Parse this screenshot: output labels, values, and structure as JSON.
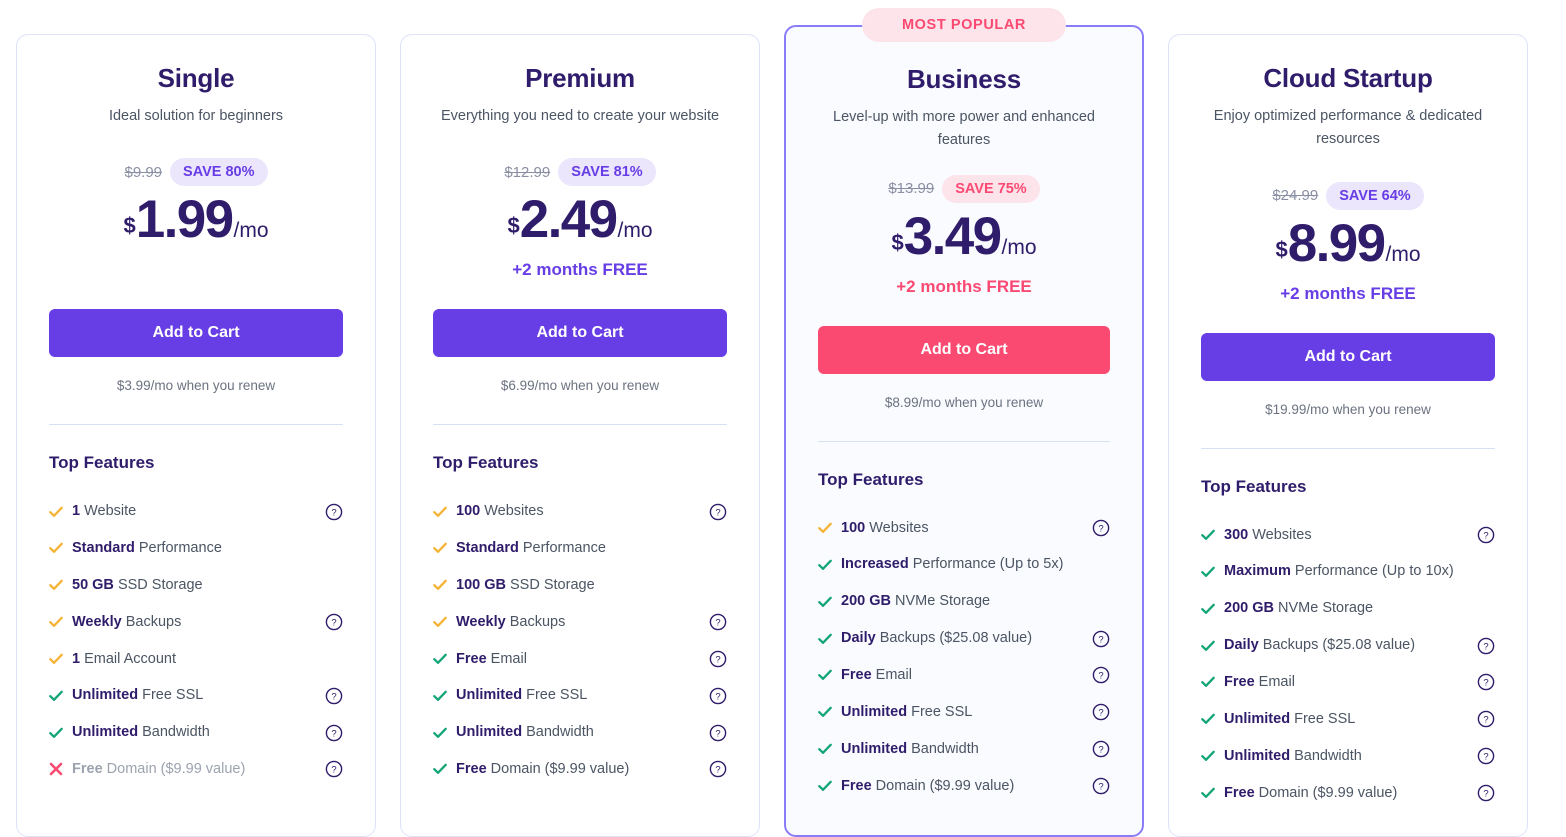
{
  "colors": {
    "purple": "#673de6",
    "pink": "#fb4a72",
    "navy": "#2f1c6a",
    "yellow_check": "#f5b335",
    "green_check": "#12a577",
    "border": "#dfe3fa",
    "featured_border": "#8a7bf7"
  },
  "popular_badge": "MOST POPULAR",
  "features_title": "Top Features",
  "cta_label": "Add to Cart",
  "currency": "$",
  "period": "/mo",
  "plans": [
    {
      "name": "Single",
      "description": "Ideal solution for beginners",
      "old_price": "$9.99",
      "save_label": "SAVE 80%",
      "amount": "1.99",
      "bonus": "",
      "renew": "$3.99/mo when you renew",
      "featured": false,
      "features": [
        {
          "bold": "1",
          "rest": " Website",
          "mark": "check-yellow",
          "help": true
        },
        {
          "bold": "Standard",
          "rest": " Performance",
          "mark": "check-yellow",
          "help": false
        },
        {
          "bold": "50 GB",
          "rest": " SSD Storage",
          "mark": "check-yellow",
          "help": false
        },
        {
          "bold": "Weekly",
          "rest": " Backups",
          "mark": "check-yellow",
          "help": true
        },
        {
          "bold": "1",
          "rest": " Email Account",
          "mark": "check-yellow",
          "help": false
        },
        {
          "bold": "Unlimited",
          "rest": " Free SSL",
          "mark": "check-green",
          "help": true
        },
        {
          "bold": "Unlimited",
          "rest": " Bandwidth",
          "mark": "check-green",
          "help": true
        },
        {
          "bold": "Free",
          "rest": " Domain ($9.99 value)",
          "mark": "cross-pink",
          "help": true,
          "muted": true
        }
      ]
    },
    {
      "name": "Premium",
      "description": "Everything you need to create your website",
      "old_price": "$12.99",
      "save_label": "SAVE 81%",
      "amount": "2.49",
      "bonus": "+2 months FREE",
      "renew": "$6.99/mo when you renew",
      "featured": false,
      "features": [
        {
          "bold": "100",
          "rest": " Websites",
          "mark": "check-yellow",
          "help": true
        },
        {
          "bold": "Standard",
          "rest": " Performance",
          "mark": "check-yellow",
          "help": false
        },
        {
          "bold": "100 GB",
          "rest": " SSD Storage",
          "mark": "check-yellow",
          "help": false
        },
        {
          "bold": "Weekly",
          "rest": " Backups",
          "mark": "check-yellow",
          "help": true
        },
        {
          "bold": "Free",
          "rest": " Email",
          "mark": "check-green",
          "help": true
        },
        {
          "bold": "Unlimited",
          "rest": " Free SSL",
          "mark": "check-green",
          "help": true
        },
        {
          "bold": "Unlimited",
          "rest": " Bandwidth",
          "mark": "check-green",
          "help": true
        },
        {
          "bold": "Free",
          "rest": " Domain ($9.99 value)",
          "mark": "check-green",
          "help": true
        }
      ]
    },
    {
      "name": "Business",
      "description": "Level-up with more power and enhanced features",
      "old_price": "$13.99",
      "save_label": "SAVE 75%",
      "amount": "3.49",
      "bonus": "+2 months FREE",
      "renew": "$8.99/mo when you renew",
      "featured": true,
      "features": [
        {
          "bold": "100",
          "rest": " Websites",
          "mark": "check-yellow",
          "help": true
        },
        {
          "bold": "Increased",
          "rest": " Performance (Up to 5x)",
          "mark": "check-green",
          "help": false
        },
        {
          "bold": "200 GB",
          "rest": " NVMe Storage",
          "mark": "check-green",
          "help": false
        },
        {
          "bold": "Daily",
          "rest": " Backups ($25.08 value)",
          "mark": "check-green",
          "help": true
        },
        {
          "bold": "Free",
          "rest": " Email",
          "mark": "check-green",
          "help": true
        },
        {
          "bold": "Unlimited",
          "rest": " Free SSL",
          "mark": "check-green",
          "help": true
        },
        {
          "bold": "Unlimited",
          "rest": " Bandwidth",
          "mark": "check-green",
          "help": true
        },
        {
          "bold": "Free",
          "rest": " Domain ($9.99 value)",
          "mark": "check-green",
          "help": true
        }
      ]
    },
    {
      "name": "Cloud Startup",
      "description": "Enjoy optimized performance & dedicated resources",
      "old_price": "$24.99",
      "save_label": "SAVE 64%",
      "amount": "8.99",
      "bonus": "+2 months FREE",
      "renew": "$19.99/mo when you renew",
      "featured": false,
      "features": [
        {
          "bold": "300",
          "rest": " Websites",
          "mark": "check-green",
          "help": true
        },
        {
          "bold": "Maximum",
          "rest": " Performance (Up to 10x)",
          "mark": "check-green",
          "help": false
        },
        {
          "bold": "200 GB",
          "rest": " NVMe Storage",
          "mark": "check-green",
          "help": false
        },
        {
          "bold": "Daily",
          "rest": " Backups ($25.08 value)",
          "mark": "check-green",
          "help": true
        },
        {
          "bold": "Free",
          "rest": " Email",
          "mark": "check-green",
          "help": true
        },
        {
          "bold": "Unlimited",
          "rest": " Free SSL",
          "mark": "check-green",
          "help": true
        },
        {
          "bold": "Unlimited",
          "rest": " Bandwidth",
          "mark": "check-green",
          "help": true
        },
        {
          "bold": "Free",
          "rest": " Domain ($9.99 value)",
          "mark": "check-green",
          "help": true
        }
      ]
    }
  ]
}
